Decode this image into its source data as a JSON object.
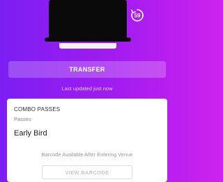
{
  "header": {
    "refresh_count": "59"
  },
  "actions": {
    "transfer_label": "TRANSFER"
  },
  "status": {
    "last_updated": "Last updated just now"
  },
  "pass": {
    "type": "COMBO PASSES",
    "category": "Passes",
    "name": "Early Bird",
    "barcode_note": "Barcode Available After Entering Venue",
    "view_barcode_label": "VIEW BARCODE"
  },
  "colors": {
    "gradient_start": "#7b1ef2",
    "gradient_end": "#cf22ee",
    "card_background": "#ffffff"
  },
  "icons": {
    "refresh": "refresh-timer-icon"
  }
}
